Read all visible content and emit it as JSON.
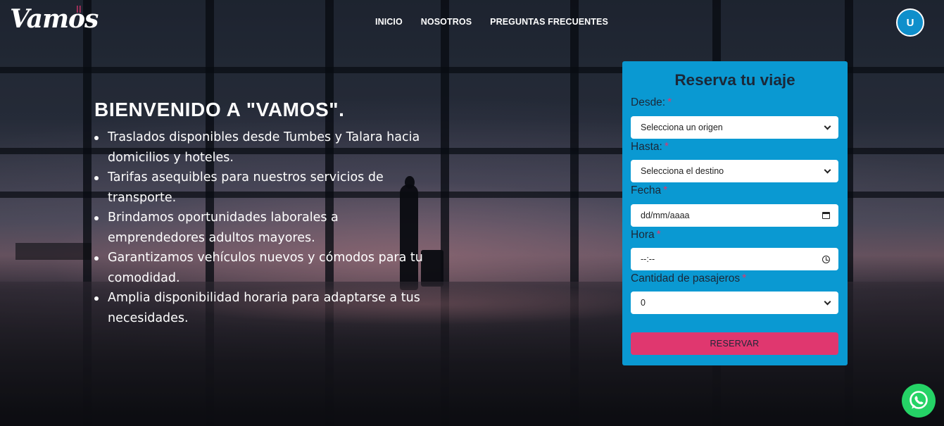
{
  "brand": {
    "name": "Vamos",
    "mark": "II",
    "accent": "#e0366f"
  },
  "nav": {
    "items": [
      "INICIO",
      "NOSOTROS",
      "PREGUNTAS FRECUENTES"
    ]
  },
  "user": {
    "initial": "U",
    "color": "#0f8fcb"
  },
  "hero": {
    "title": "BIENVENIDO A \"VAMOS\".",
    "features": [
      "Traslados disponibles desde Tumbes y Talara hacia domicilios y hoteles.",
      "Tarifas asequibles para nuestros servicios de transporte.",
      "Brindamos oportunidades laborales a emprendedores adultos mayores.",
      "Garantizamos vehículos nuevos y cómodos para tu comodidad.",
      "Amplia disponibilidad horaria para adaptarse a tus necesidades."
    ]
  },
  "booking": {
    "title": "Reserva tu viaje",
    "required_marker": "*",
    "card_color": "#0a99d2",
    "from": {
      "label": "Desde:",
      "value": "Selecciona un origen",
      "icon": "chevron-down-icon"
    },
    "to": {
      "label": "Hasta:",
      "value": "Selecciona el destino",
      "icon": "chevron-down-icon"
    },
    "date": {
      "label": "Fecha",
      "value": "dd/mm/aaaa",
      "icon": "calendar-icon"
    },
    "time": {
      "label": "Hora",
      "value": "--:--",
      "icon": "clock-icon"
    },
    "passengers": {
      "label": "Cantidad de pasajeros",
      "value": "0",
      "icon": "chevron-down-icon"
    },
    "submit_label": "RESERVAR",
    "submit_color": "#e0376f"
  },
  "whatsapp": {
    "icon": "whatsapp-icon",
    "color": "#25d366"
  }
}
